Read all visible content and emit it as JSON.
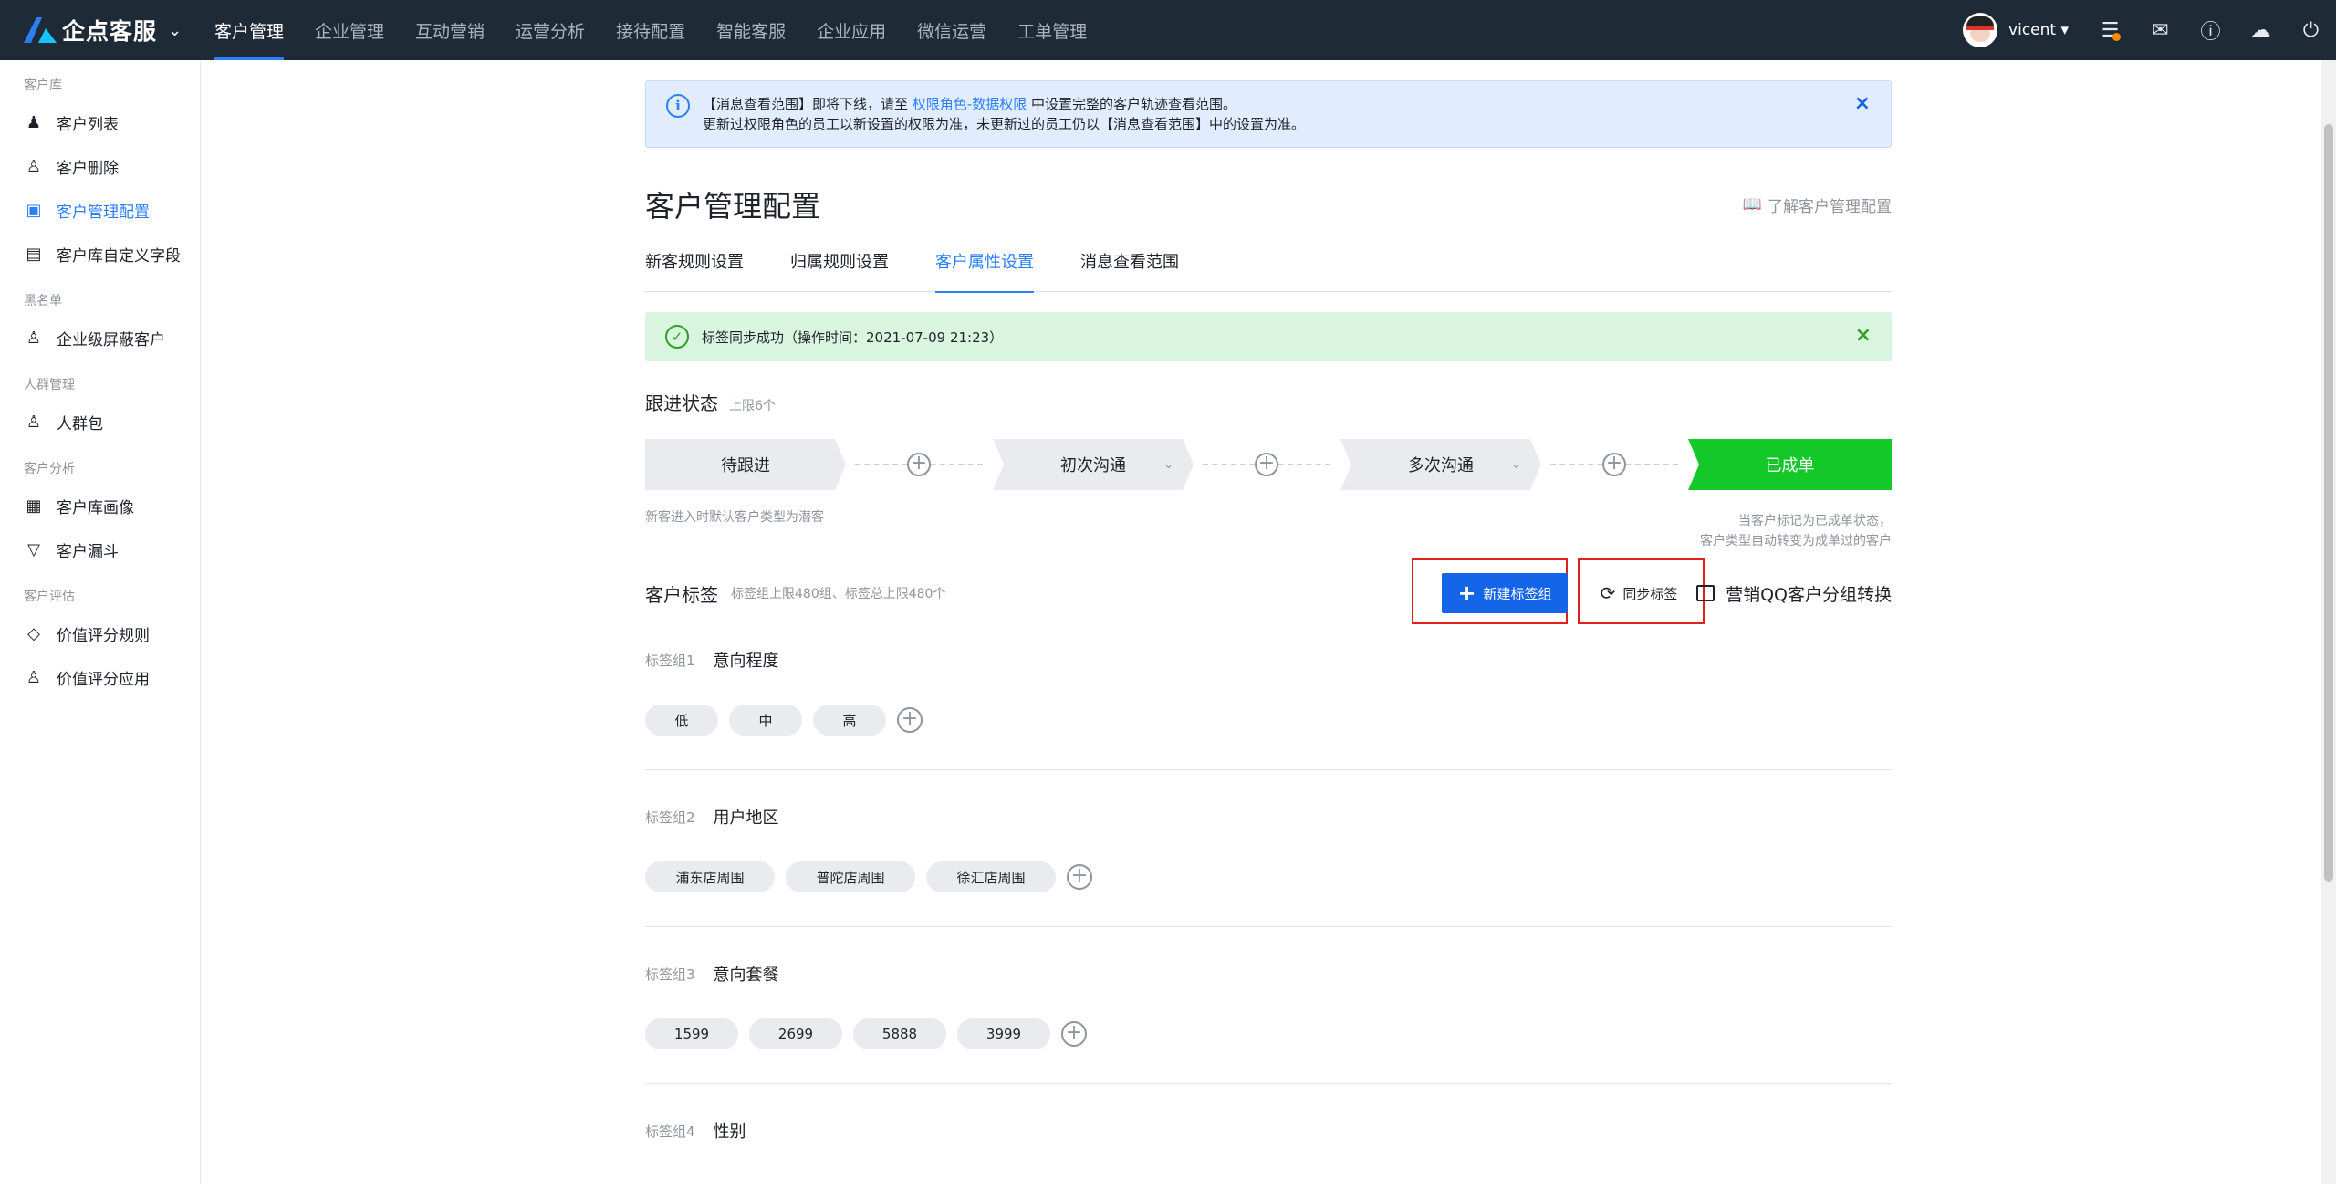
{
  "topbar": {
    "brand": "企点客服",
    "nav": [
      "客户管理",
      "企业管理",
      "互动营销",
      "运营分析",
      "接待配置",
      "智能客服",
      "企业应用",
      "微信运营",
      "工单管理"
    ],
    "active_nav": "客户管理",
    "username": "vicent"
  },
  "sidebar": {
    "groups": [
      {
        "title": "客户库",
        "items": [
          "客户列表",
          "客户删除",
          "客户管理配置",
          "客户库自定义字段"
        ]
      },
      {
        "title": "黑名单",
        "items": [
          "企业级屏蔽客户"
        ]
      },
      {
        "title": "人群管理",
        "items": [
          "人群包"
        ]
      },
      {
        "title": "客户分析",
        "items": [
          "客户库画像",
          "客户漏斗"
        ]
      },
      {
        "title": "客户评估",
        "items": [
          "价值评分规则",
          "价值评分应用"
        ]
      }
    ],
    "active_item": "客户管理配置"
  },
  "notice": {
    "line1_a": "【消息查看范围】即将下线，请至",
    "line1_link": "权限角色-数据权限",
    "line1_b": "中设置完整的客户轨迹查看范围。",
    "line2": "更新过权限角色的员工以新设置的权限为准，未更新过的员工仍以【消息查看范围】中的设置为准。"
  },
  "page": {
    "title": "客户管理配置",
    "help_link": "了解客户管理配置",
    "tabs": [
      "新客规则设置",
      "归属规则设置",
      "客户属性设置",
      "消息查看范围"
    ],
    "active_tab": "客户属性设置"
  },
  "success": {
    "text": "标签同步成功（操作时间：2021-07-09 21:23）"
  },
  "follow": {
    "title": "跟进状态",
    "limit": "上限6个",
    "stages": [
      "待跟进",
      "初次沟通",
      "多次沟通",
      "已成单"
    ],
    "hint_left": "新客进入时默认客户类型为潜客",
    "hint_right_1": "当客户标记为已成单状态，",
    "hint_right_2": "客户类型自动转变为成单过的客户"
  },
  "tags": {
    "title": "客户标签",
    "limit": "标签组上限480组、标签总上限480个",
    "btn_new": "新建标签组",
    "btn_sync": "同步标签",
    "btn_qq": "营销QQ客户分组转换",
    "groups": [
      {
        "key": "标签组1",
        "name": "意向程度",
        "tags": [
          "低",
          "中",
          "高"
        ]
      },
      {
        "key": "标签组2",
        "name": "用户地区",
        "tags": [
          "浦东店周围",
          "普陀店周围",
          "徐汇店周围"
        ]
      },
      {
        "key": "标签组3",
        "name": "意向套餐",
        "tags": [
          "1599",
          "2699",
          "5888",
          "3999"
        ]
      },
      {
        "key": "标签组4",
        "name": "性别",
        "tags": []
      }
    ]
  },
  "colors": {
    "accent": "#2d7ff9",
    "topbar": "#1f2a37",
    "success": "#14c82a",
    "highlight": "#e0201a"
  }
}
